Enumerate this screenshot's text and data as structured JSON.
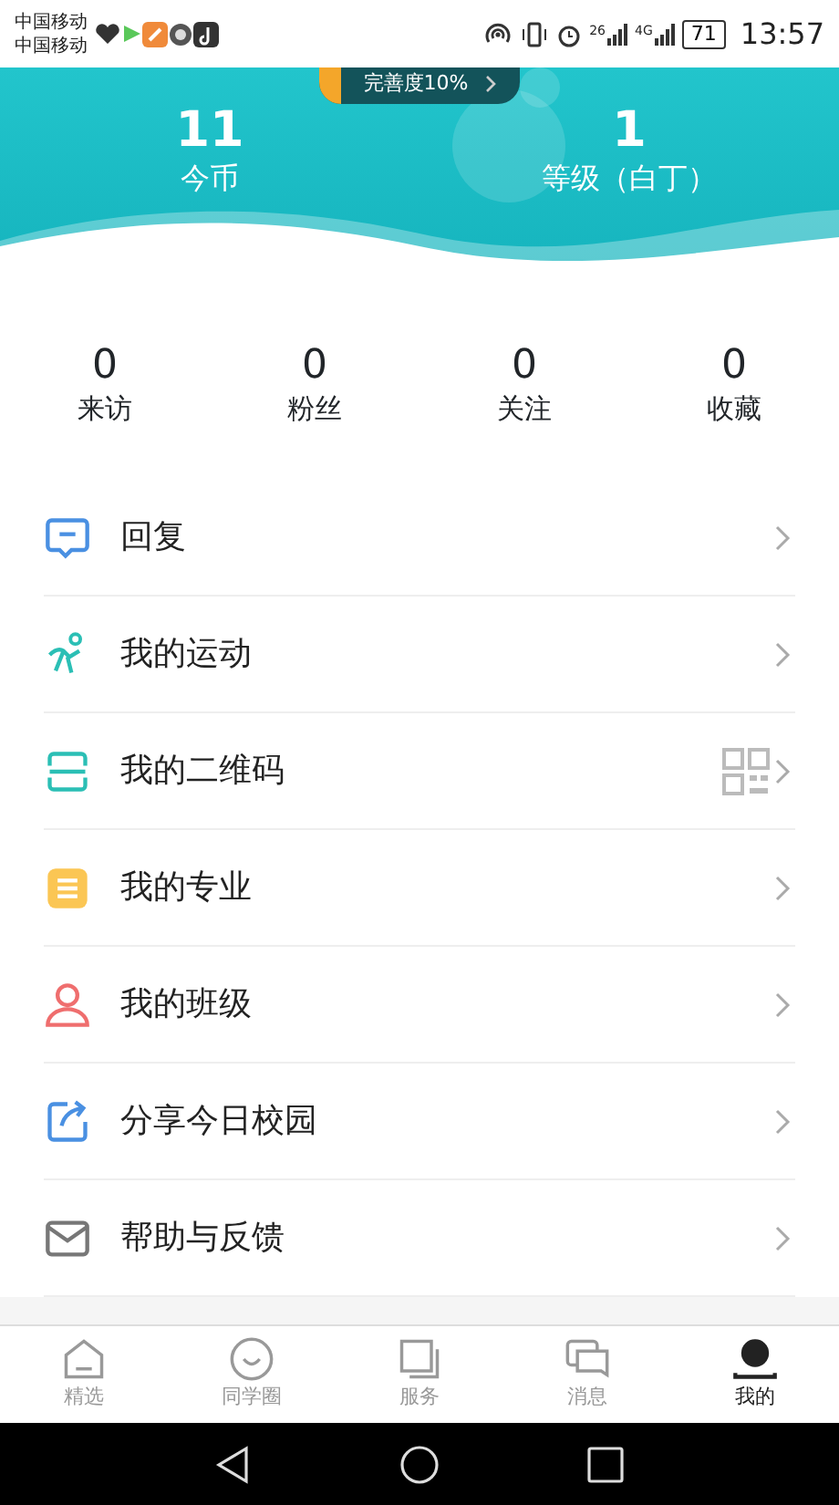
{
  "status_bar": {
    "carriers": [
      "中国移动",
      "中国移动"
    ],
    "signal_labels": [
      "26",
      "4G"
    ],
    "battery": "71",
    "time": "13:57"
  },
  "header": {
    "completeness": "完善度10%",
    "stats": [
      {
        "value": "11",
        "label": "今币"
      },
      {
        "value": "1",
        "label": "等级（白丁）"
      }
    ]
  },
  "counts": [
    {
      "value": "0",
      "label": "来访"
    },
    {
      "value": "0",
      "label": "粉丝"
    },
    {
      "value": "0",
      "label": "关注"
    },
    {
      "value": "0",
      "label": "收藏"
    }
  ],
  "menu": [
    {
      "label": "回复",
      "qr": false
    },
    {
      "label": "我的运动",
      "qr": false
    },
    {
      "label": "我的二维码",
      "qr": true
    },
    {
      "label": "我的专业",
      "qr": false
    },
    {
      "label": "我的班级",
      "qr": false
    },
    {
      "label": "分享今日校园",
      "qr": false
    },
    {
      "label": "帮助与反馈",
      "qr": false
    }
  ],
  "tabs": [
    {
      "label": "精选",
      "selected": false
    },
    {
      "label": "同学圈",
      "selected": false
    },
    {
      "label": "服务",
      "selected": false
    },
    {
      "label": "消息",
      "selected": false
    },
    {
      "label": "我的",
      "selected": true
    }
  ]
}
